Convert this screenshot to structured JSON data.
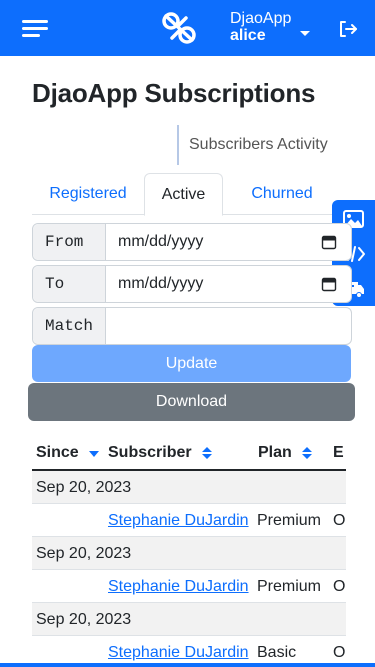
{
  "header": {
    "app_name": "DjaoApp",
    "user_name": "alice"
  },
  "page": {
    "title": "DjaoApp Subscriptions",
    "sub_nav": "Subscribers Activity"
  },
  "tabs": [
    {
      "label": "Registered",
      "active": false
    },
    {
      "label": "Active",
      "active": true
    },
    {
      "label": "Churned",
      "active": false
    }
  ],
  "filters": {
    "from_label": "From",
    "from_value": "mm/dd/yyyy",
    "to_label": "To",
    "to_value": "mm/dd/yyyy",
    "match_label": "Match",
    "match_value": ""
  },
  "buttons": {
    "update": "Update",
    "download": "Download"
  },
  "table": {
    "columns": [
      "Since",
      "Subscriber",
      "Plan",
      "E"
    ],
    "groups": [
      {
        "date": "Sep 20, 2023",
        "subscriber": "Stephanie DuJardin",
        "plan": "Premium",
        "extra": "O"
      },
      {
        "date": "Sep 20, 2023",
        "subscriber": "Stephanie DuJardin",
        "plan": "Premium",
        "extra": "O"
      },
      {
        "date": "Sep 20, 2023",
        "subscriber": "Stephanie DuJardin",
        "plan": "Basic",
        "extra": "O"
      }
    ]
  },
  "colors": {
    "primary": "#0d6efd",
    "update_button": "#6ea8fe",
    "download_button": "#6c757d"
  },
  "icons": [
    "menu-icon",
    "djaoapp-logo-icon",
    "caret-down-icon",
    "logout-icon",
    "image-icon",
    "code-icon",
    "ambulance-icon",
    "sort-desc-icon",
    "sort-both-icon",
    "calendar-icon"
  ]
}
